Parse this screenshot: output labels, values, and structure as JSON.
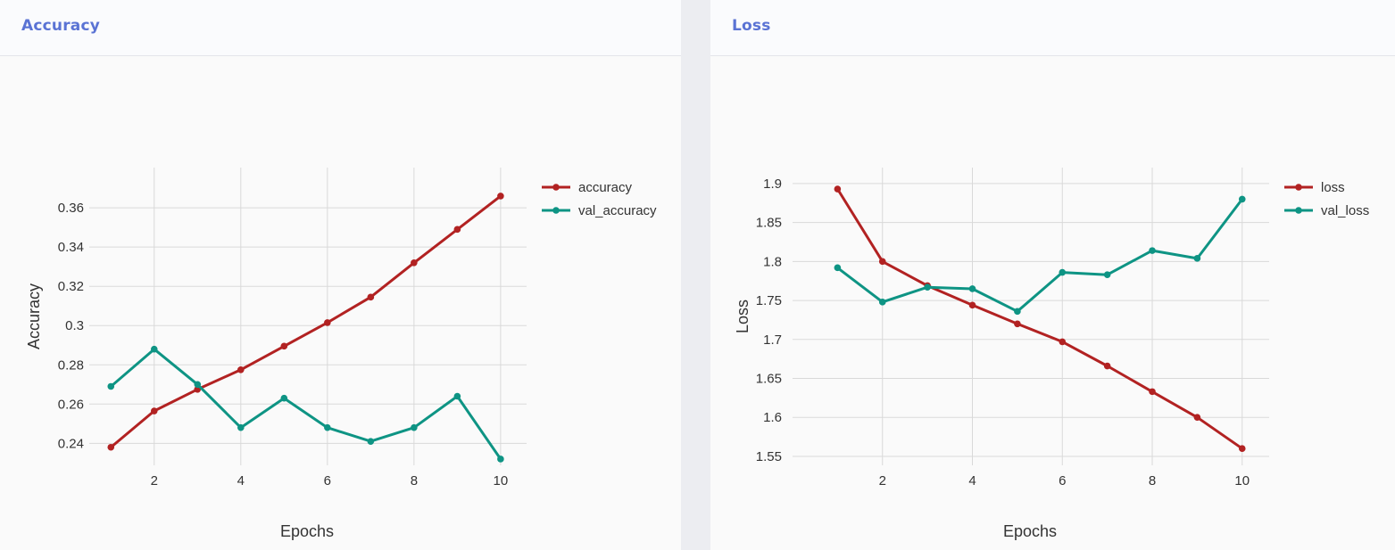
{
  "panels": {
    "accuracy": {
      "title": "Accuracy"
    },
    "loss": {
      "title": "Loss"
    }
  },
  "chart_data": [
    {
      "type": "line",
      "title": "",
      "xlabel": "Epochs",
      "ylabel": "Accuracy",
      "x": [
        1,
        2,
        3,
        4,
        5,
        6,
        7,
        8,
        9,
        10
      ],
      "xticks": [
        2,
        4,
        6,
        8,
        10
      ],
      "xlim": [
        0.5,
        10.6
      ],
      "yticks": [
        0.24,
        0.26,
        0.28,
        0.3,
        0.32,
        0.34,
        0.36
      ],
      "ytick_labels": [
        "0.24",
        "0.26",
        "0.28",
        "0.3",
        "0.32",
        "0.34",
        "0.36"
      ],
      "ylim": [
        0.2288,
        0.3805
      ],
      "grid": true,
      "legend": "top-right",
      "series": [
        {
          "name": "accuracy",
          "color": "#b22222",
          "values": [
            0.238,
            0.2565,
            0.2675,
            0.2775,
            0.2895,
            0.3015,
            0.3145,
            0.332,
            0.349,
            0.366
          ]
        },
        {
          "name": "val_accuracy",
          "color": "#0e9484",
          "values": [
            0.269,
            0.288,
            0.27,
            0.248,
            0.263,
            0.248,
            0.241,
            0.248,
            0.264,
            0.232
          ]
        }
      ]
    },
    {
      "type": "line",
      "title": "",
      "xlabel": "Epochs",
      "ylabel": "Loss",
      "x": [
        1,
        2,
        3,
        4,
        5,
        6,
        7,
        8,
        9,
        10
      ],
      "xticks": [
        2,
        4,
        6,
        8,
        10
      ],
      "xlim": [
        0.0,
        10.6
      ],
      "yticks": [
        1.55,
        1.6,
        1.65,
        1.7,
        1.75,
        1.8,
        1.85,
        1.9
      ],
      "ytick_labels": [
        "1.55",
        "1.6",
        "1.65",
        "1.7",
        "1.75",
        "1.8",
        "1.85",
        "1.9"
      ],
      "ylim": [
        1.5385,
        1.9205
      ],
      "grid": true,
      "legend": "top-right",
      "series": [
        {
          "name": "loss",
          "color": "#b22222",
          "values": [
            1.893,
            1.8,
            1.769,
            1.744,
            1.72,
            1.697,
            1.666,
            1.633,
            1.6,
            1.56
          ]
        },
        {
          "name": "val_loss",
          "color": "#0e9484",
          "values": [
            1.792,
            1.748,
            1.767,
            1.765,
            1.736,
            1.786,
            1.783,
            1.814,
            1.804,
            1.88
          ]
        }
      ]
    }
  ]
}
